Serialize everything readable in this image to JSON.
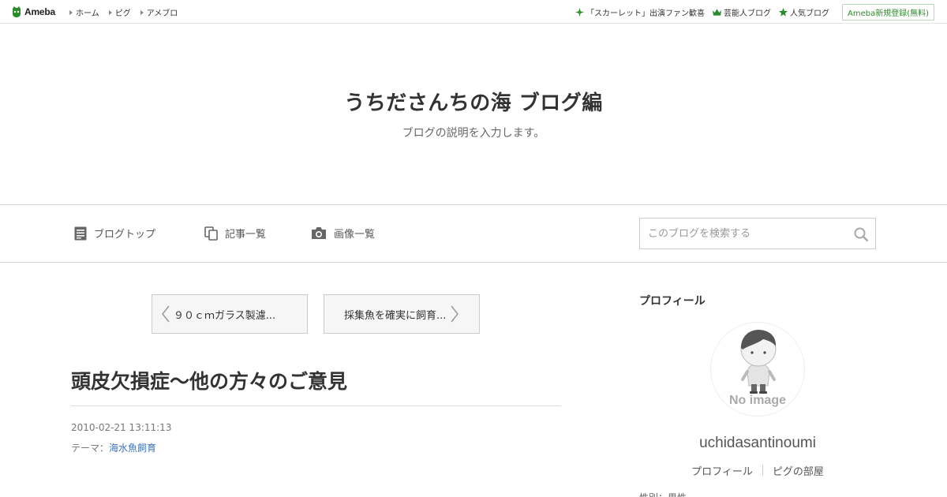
{
  "topbar": {
    "logo_text": "Ameba",
    "nav": [
      {
        "label": "ホーム"
      },
      {
        "label": "ピグ"
      },
      {
        "label": "アメブロ"
      }
    ],
    "links": [
      {
        "label": "「スカーレット」出演ファン歓喜",
        "icon": "sparkle-icon"
      },
      {
        "label": "芸能人ブログ",
        "icon": "crown-icon"
      },
      {
        "label": "人気ブログ",
        "icon": "star-icon"
      }
    ],
    "signup_label": "Ameba新規登録(無料)",
    "accent": "#2d8a2d"
  },
  "header": {
    "title": "うちださんちの海 ブログ編",
    "description": "ブログの説明を入力します。"
  },
  "nav": {
    "items": [
      {
        "label": "ブログトップ",
        "icon": "document-icon"
      },
      {
        "label": "記事一覧",
        "icon": "copy-icon"
      },
      {
        "label": "画像一覧",
        "icon": "camera-icon"
      }
    ],
    "search_placeholder": "このブログを検索する"
  },
  "pager": {
    "prev_label": "９０ｃｍガラス製濾...",
    "next_label": "採集魚を確実に飼育..."
  },
  "entry": {
    "title": "頭皮欠損症～他の方々のご意見",
    "date": "2010-02-21 13:11:13",
    "theme_prefix": "テーマ：",
    "theme": "海水魚飼育"
  },
  "sidebar": {
    "heading": "プロフィール",
    "avatar_text": "No image",
    "username": "uchidasantinoumi",
    "links": [
      {
        "label": "プロフィール"
      },
      {
        "label": "ピグの部屋"
      }
    ],
    "cut_text": "性別：男性"
  },
  "colors": {
    "link": "#3b73b9",
    "border": "#d6d6d6"
  }
}
